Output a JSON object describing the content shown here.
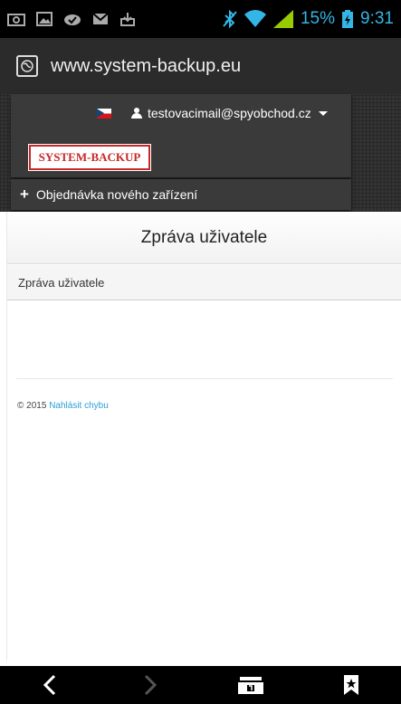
{
  "statusbar": {
    "battery_percent": "15%",
    "time": "9:31",
    "left_icons": [
      "screenshot-icon",
      "image-icon",
      "checkmark-cloud-icon",
      "mail-icon",
      "download-icon"
    ],
    "right_icons": [
      "bluetooth-off-icon",
      "wifi-icon",
      "signal-icon",
      "battery-icon"
    ],
    "accent_color": "#33b5e5"
  },
  "browser": {
    "url": "www.system-backup.eu"
  },
  "header": {
    "user_email": "testovacimail@spyobchod.cz",
    "logo_text": "SYSTEM-BACKUP",
    "order_link": "Objednávka nového zařízení",
    "language": "cs"
  },
  "main": {
    "page_title": "Zpráva uživatele",
    "section_title": "Zpráva uživatele"
  },
  "footer": {
    "copyright": "© 2015",
    "report_link": "Nahlásit chybu"
  },
  "navbar": {
    "buttons": [
      "back-icon",
      "forward-icon",
      "tabs-icon",
      "bookmark-icon"
    ]
  }
}
